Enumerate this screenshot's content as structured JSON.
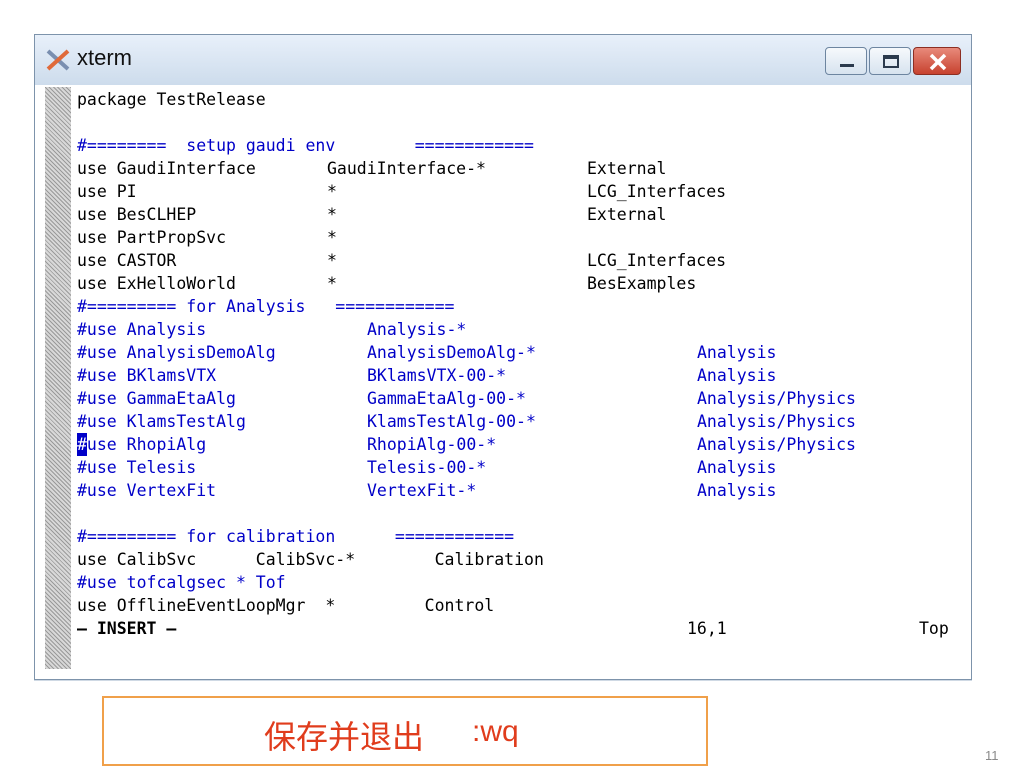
{
  "window": {
    "title": "xterm",
    "icon": "xterm-icon",
    "controls": [
      "minimize-icon",
      "maximize-icon",
      "close-icon"
    ],
    "close_color": "#c7422f"
  },
  "editor": {
    "lines": [
      {
        "color": "black",
        "cols": [
          "package TestRelease",
          "",
          "",
          ""
        ]
      },
      {
        "color": "black",
        "cols": [
          "",
          "",
          "",
          ""
        ]
      },
      {
        "color": "blue",
        "cols": [
          "#========  setup gaudi env        ============",
          "",
          "",
          ""
        ]
      },
      {
        "color": "black",
        "cols": [
          "use GaudiInterface",
          "GaudiInterface-*",
          "External",
          ""
        ]
      },
      {
        "color": "black",
        "cols": [
          "use PI",
          "*",
          "LCG_Interfaces",
          ""
        ]
      },
      {
        "color": "black",
        "cols": [
          "use BesCLHEP",
          "*",
          "External",
          ""
        ]
      },
      {
        "color": "black",
        "cols": [
          "use PartPropSvc",
          "*",
          "",
          ""
        ]
      },
      {
        "color": "black",
        "cols": [
          "use CASTOR",
          "*",
          "LCG_Interfaces",
          ""
        ]
      },
      {
        "color": "black",
        "cols": [
          "use ExHelloWorld",
          "*",
          "BesExamples",
          ""
        ]
      },
      {
        "color": "blue",
        "cols": [
          "#========= for Analysis   ============",
          "",
          "",
          ""
        ]
      },
      {
        "color": "blue",
        "cols": [
          "#use Analysis",
          "",
          "Analysis-*",
          ""
        ]
      },
      {
        "color": "blue",
        "cols": [
          "#use AnalysisDemoAlg",
          "",
          "AnalysisDemoAlg-*",
          "Analysis"
        ]
      },
      {
        "color": "blue",
        "cols": [
          "#use BKlamsVTX",
          "",
          "BKlamsVTX-00-*",
          "Analysis"
        ]
      },
      {
        "color": "blue",
        "cols": [
          "#use GammaEtaAlg",
          "",
          "GammaEtaAlg-00-*",
          "Analysis/Physics"
        ]
      },
      {
        "color": "blue",
        "cols": [
          "#use KlamsTestAlg",
          "",
          "KlamsTestAlg-00-*",
          "Analysis/Physics"
        ]
      },
      {
        "color": "blue",
        "cols": [
          "#use RhopiAlg",
          "",
          "RhopiAlg-00-*",
          "Analysis/Physics"
        ],
        "cursor": true
      },
      {
        "color": "blue",
        "cols": [
          "#use Telesis",
          "",
          "Telesis-00-*",
          "Analysis"
        ]
      },
      {
        "color": "blue",
        "cols": [
          "#use VertexFit",
          "",
          "VertexFit-*",
          "Analysis"
        ]
      },
      {
        "color": "black",
        "cols": [
          "",
          "",
          "",
          ""
        ]
      },
      {
        "color": "blue",
        "cols": [
          "#========= for calibration      ============",
          "",
          "",
          ""
        ]
      },
      {
        "color": "black",
        "cols": [
          "use CalibSvc      CalibSvc-*        Calibration",
          "",
          "",
          ""
        ]
      },
      {
        "color": "blue",
        "cols": [
          "#use tofcalgsec * Tof",
          "",
          "",
          ""
        ]
      },
      {
        "color": "black",
        "cols": [
          "use OfflineEventLoopMgr  *         Control",
          "",
          "",
          ""
        ]
      }
    ],
    "status": {
      "mode": "— INSERT —",
      "position": "16,1",
      "scroll": "Top"
    }
  },
  "callout": {
    "text": "保存并退出",
    "command": ":wq",
    "border_color": "#f0a04a",
    "text_color": "#e03c1c"
  },
  "page_number": "11"
}
